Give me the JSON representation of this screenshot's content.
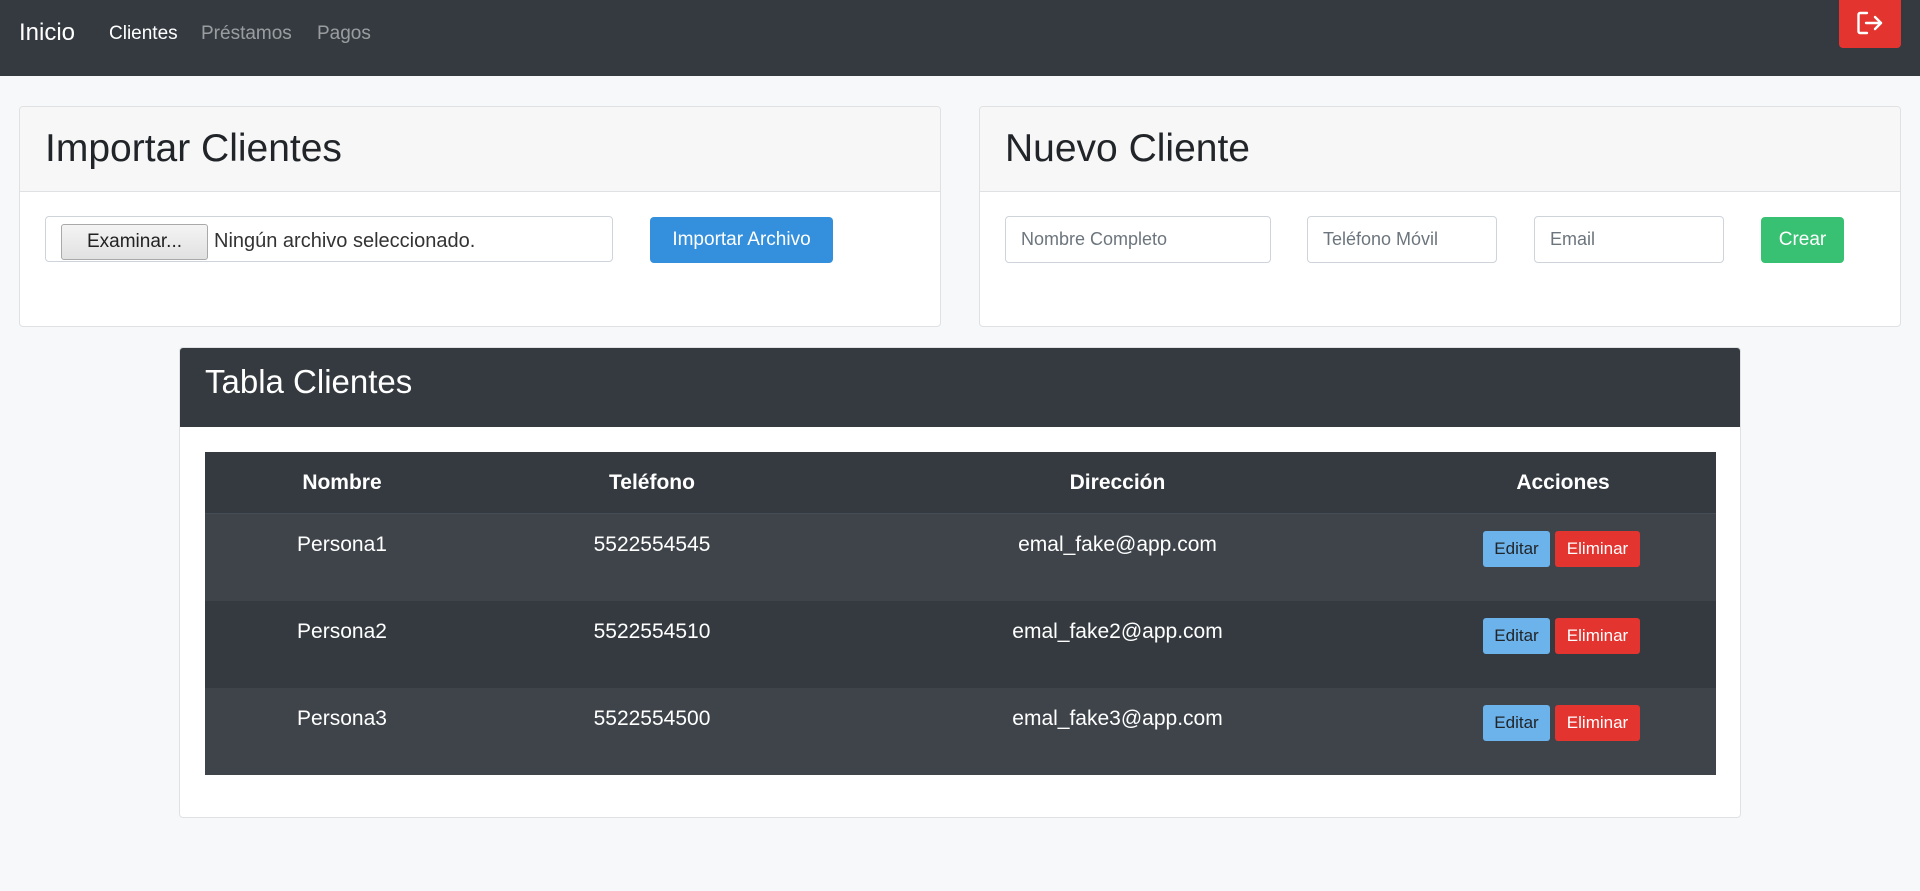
{
  "navbar": {
    "brand": "Inicio",
    "links": [
      {
        "label": "Clientes"
      },
      {
        "label": "Préstamos"
      },
      {
        "label": "Pagos"
      }
    ],
    "logout_icon": "sign-out-icon"
  },
  "import_card": {
    "title": "Importar Clientes",
    "file_button": "Examinar...",
    "file_status": "Ningún archivo seleccionado.",
    "submit_label": "Importar Archivo"
  },
  "new_client_card": {
    "title": "Nuevo Cliente",
    "name_placeholder": "Nombre Completo",
    "phone_placeholder": "Teléfono Móvil",
    "email_placeholder": "Email",
    "submit_label": "Crear"
  },
  "table_card": {
    "title": "Tabla Clientes",
    "columns": [
      "Nombre",
      "Teléfono",
      "Dirección",
      "Acciones"
    ],
    "rows": [
      {
        "nombre": "Persona1",
        "telefono": "5522554545",
        "direccion": "emal_fake@app.com",
        "edit_label": "Editar",
        "delete_label": "Eliminar"
      },
      {
        "nombre": "Persona2",
        "telefono": "5522554510",
        "direccion": "emal_fake2@app.com",
        "edit_label": "Editar",
        "delete_label": "Eliminar"
      },
      {
        "nombre": "Persona3",
        "telefono": "5522554500",
        "direccion": "emal_fake3@app.com",
        "edit_label": "Editar",
        "delete_label": "Eliminar"
      }
    ]
  },
  "colors": {
    "navbar": "#343a40",
    "primary": "#3490dc",
    "success": "#38c172",
    "danger": "#e3342f",
    "info": "#6cb2eb"
  }
}
